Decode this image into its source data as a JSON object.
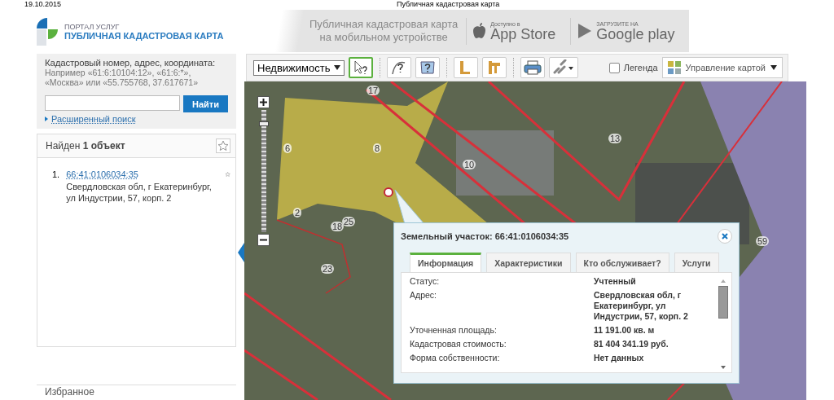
{
  "print_header": {
    "date": "19.10.2015",
    "title": "Публичная кадастровая карта"
  },
  "logo": {
    "caption": "ПОРТАЛ УСЛУГ",
    "title": "ПУБЛИЧНАЯ КАДАСТРОВАЯ КАРТА"
  },
  "mobile_banner": {
    "lines": [
      "Публичная кадастровая карта",
      "на мобильном устройстве"
    ],
    "stores": [
      {
        "kind": "apple",
        "small": "Доступно в",
        "name": "App Store"
      },
      {
        "kind": "google",
        "small": "ЗАГРУЗИТЕ НА",
        "name": "Google play"
      }
    ]
  },
  "search": {
    "label": "Кадастровый номер, адрес, координата:",
    "hint_lines": [
      "Например «61:6:10104:12», «61:6:*»,",
      "«Москва» или «55.755768, 37.617671»"
    ],
    "button": "Найти",
    "advanced_link": "Расширенный поиск"
  },
  "results": {
    "title": "Найден **1 объект**",
    "items": [
      {
        "number": "1.",
        "link": "66:41:0106034:35",
        "address": "Свердловская обл, г Екатеринбург, ул Индустрии, 57, корп. 2"
      }
    ]
  },
  "favorites": {
    "title": "Избранное"
  },
  "toolbar": {
    "layer_select": "Недвижимость",
    "tools": [
      {
        "kind": "identify",
        "selected": true
      },
      {
        "kind": "curve",
        "selected": false
      },
      {
        "kind": "area",
        "selected": false
      },
      {
        "kind": "distance",
        "selected": false
      },
      {
        "kind": "measure-area",
        "selected": false
      },
      {
        "kind": "print",
        "selected": false
      },
      {
        "kind": "link",
        "selected": false
      }
    ],
    "legend": {
      "label": "Легенда",
      "checked": false
    },
    "map_control": "Управление картой"
  },
  "map": {
    "zoom": {
      "level": 0.9
    },
    "labels": [
      "17",
      "6",
      "8",
      "10",
      "13",
      "2",
      "18",
      "25",
      "23",
      "59"
    ]
  },
  "popup": {
    "title": "Земельный участок: 66:41:0106034:35",
    "tabs": [
      {
        "label": "Информация",
        "selected": true
      },
      {
        "label": "Характеристики",
        "selected": false
      },
      {
        "label": "Кто обслуживает?",
        "selected": false
      },
      {
        "label": "Услуги",
        "selected": false
      }
    ],
    "rows": [
      {
        "label": "Статус:",
        "value": "Учтенный"
      },
      {
        "label": "Адрес:",
        "value": "Свердловская обл, г Екатеринбург, ул Индустрии, 57, корп. 2"
      },
      {
        "label": "Уточненная площадь:",
        "value": "11 191.00 кв. м"
      },
      {
        "label": "Кадастровая стоимость:",
        "value": "81 404 341.19 руб."
      },
      {
        "label": "Форма собственности:",
        "value": "Нет данных"
      }
    ]
  }
}
